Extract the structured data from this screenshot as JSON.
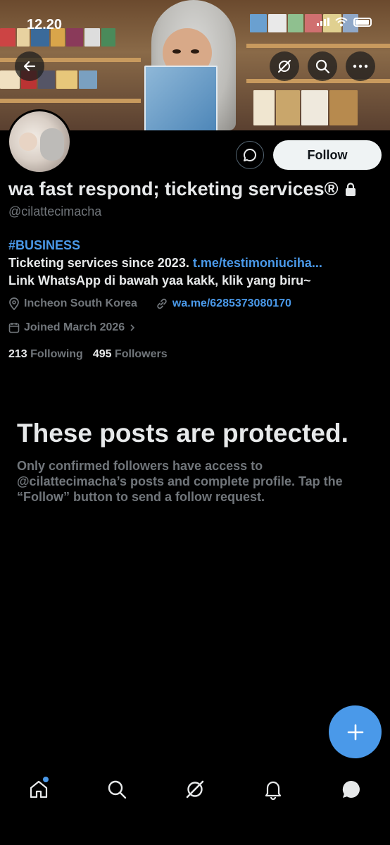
{
  "status_bar": {
    "time": "12.20"
  },
  "profile": {
    "display_name": "wa fast respond; ticketing services®",
    "handle": "@cilattecimacha",
    "follow_label": "Follow",
    "bio_hashtag": "#BUSINESS",
    "bio_line1": "Ticketing services since 2023. ",
    "bio_link": "t.me/testimoniuciha...",
    "bio_line2": "Link WhatsApp di bawah yaa kakk, klik yang biru~",
    "location": "Incheon South Korea",
    "website": "wa.me/6285373080170",
    "joined": "Joined March 2026",
    "following_count": "213",
    "following_label": "Following",
    "followers_count": "495",
    "followers_label": "Followers"
  },
  "protected_notice": {
    "title": "These posts are protected.",
    "body": "Only confirmed followers have access to @cilattecimacha’s posts and complete profile. Tap the “Follow” button to send a follow request."
  },
  "icons": {
    "back": "arrow-left-icon",
    "grok": "grok-icon",
    "search": "search-icon",
    "more": "more-icon",
    "message": "message-icon",
    "lock": "lock-icon",
    "location": "location-icon",
    "link": "link-icon",
    "calendar": "calendar-icon",
    "compose": "plus-icon"
  },
  "colors": {
    "accent": "#4a99e9",
    "muted": "#71767b",
    "text": "#e7e9ea",
    "background": "#000000"
  }
}
